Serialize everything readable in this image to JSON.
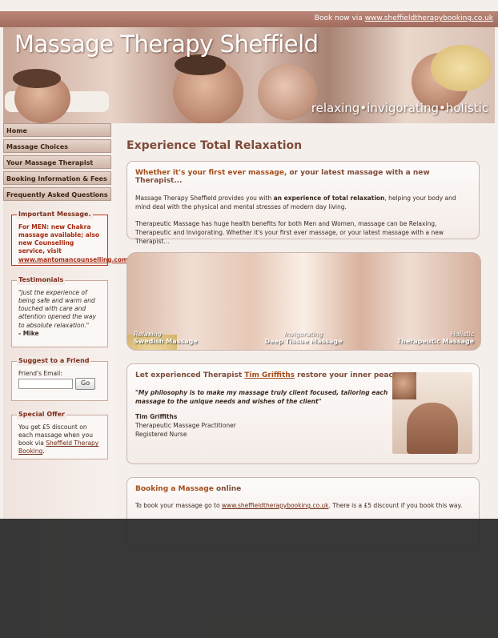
{
  "topbar": {
    "book_prefix": "Book now via",
    "book_link": "www.sheffieldtherapybooking.co.uk"
  },
  "header": {
    "title": "Massage Therapy Sheffield",
    "tagline": "relaxing•invigorating•holistic"
  },
  "nav": [
    "Home",
    "Massage Choices",
    "Your Massage Therapist",
    "Booking Information & Fees",
    "Frequently Asked Questions"
  ],
  "important": {
    "title": "Important Message.",
    "text": "For MEN: new Chakra massage available; also new Counselling service, visit",
    "link": "www.mantomancounselling.com"
  },
  "testimonials": {
    "title": "Testimonials",
    "quote": "\"Just the experience of being safe and warm and touched with care and attention opened the way to absolute relaxation.\"",
    "author": "- Mike"
  },
  "suggest": {
    "title": "Suggest to a Friend",
    "label": "Friend's Email:",
    "button": "Go"
  },
  "offer": {
    "title": "Special Offer",
    "text": "You get £5 discount on each massage when you book via",
    "link": "Sheffield Therapy Booking",
    "end": "."
  },
  "main": {
    "heading": "Experience Total Relaxation",
    "intro": {
      "title_bold": "Whether it's your first ever massage,",
      "title_rest": " or your latest massage with a new Therapist...",
      "p1_a": "Massage Therapy Sheffield provides you with ",
      "p1_b": "an experience of total relaxation",
      "p1_c": ", helping your body and mind deal with the physical and mental stresses of modern day living.",
      "p2": "Therapeutic Massage has huge health benefits for both Men and Women, massage can be Relaxing, Therapeutic and Invigorating. Whether it's your first ever massage, or your latest massage with a new Therapist..."
    },
    "banner": [
      {
        "top": "Relaxing",
        "bottom": "Swedish Massage"
      },
      {
        "top": "Invigorating",
        "bottom": "Deep Tissue Massage"
      },
      {
        "top": "Holistic",
        "bottom": "Therapeutic Massage"
      }
    ],
    "therapist": {
      "title_a": "Let experienced Therapist ",
      "title_link": "Tim Griffiths",
      "title_b": " restore your inner peace",
      "quote": "\"My philosophy is to make my massage truly client focused, tailoring each massage to the unique needs and wishes of the client\"",
      "name": "Tim Griffiths",
      "role1": "Therapeutic Massage Practitioner",
      "role2": "Registered Nurse"
    },
    "booking": {
      "title_a": "Booking a Massage",
      "title_b": " online",
      "text_a": "To book your massage go to ",
      "link": "www.sheffieldtherapybooking.co.uk",
      "text_b": ". There is a £5 discount if you book this way."
    }
  },
  "colors": {
    "accent": "#a44d1b",
    "nav_bg": "#d9c2b7",
    "topbar": "#a8705f"
  }
}
